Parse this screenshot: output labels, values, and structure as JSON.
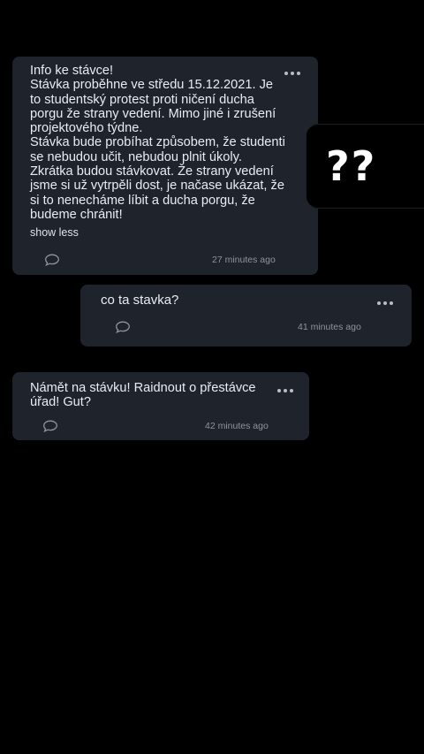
{
  "cards": [
    {
      "text": "Info ke stávce!\nStávka proběhne ve středu 15.12.2021. Je to studentský protest proti ničení ducha porgu že strany vedení. Mimo jiné i zrušení projektového týdne.\nStávka bude probíhat způsobem, že studenti se nebudou učit, nebudou plnit úkoly.\nZkrátka budou stávkovat. Že strany vedení jsme si už vytrpěli dost, je načase ukázat, že si to nenecháme líbit a ducha porgu, že budeme chránit!",
      "toggle_label": "show less",
      "time": "27 minutes ago"
    },
    {
      "text": "co ta stavka?",
      "time": "41 minutes ago"
    },
    {
      "text": "Námět na stávku! Raidnout o přestávce úřad! Gut?",
      "time": "42 minutes ago"
    }
  ],
  "overlay": {
    "text": "??"
  },
  "icons": {
    "comment": "speech-bubble-icon",
    "more": "more-dots-icon"
  },
  "colors": {
    "background": "#000000",
    "card": "#1f232c",
    "text": "#e9ecf1",
    "muted": "#8d93a0"
  }
}
